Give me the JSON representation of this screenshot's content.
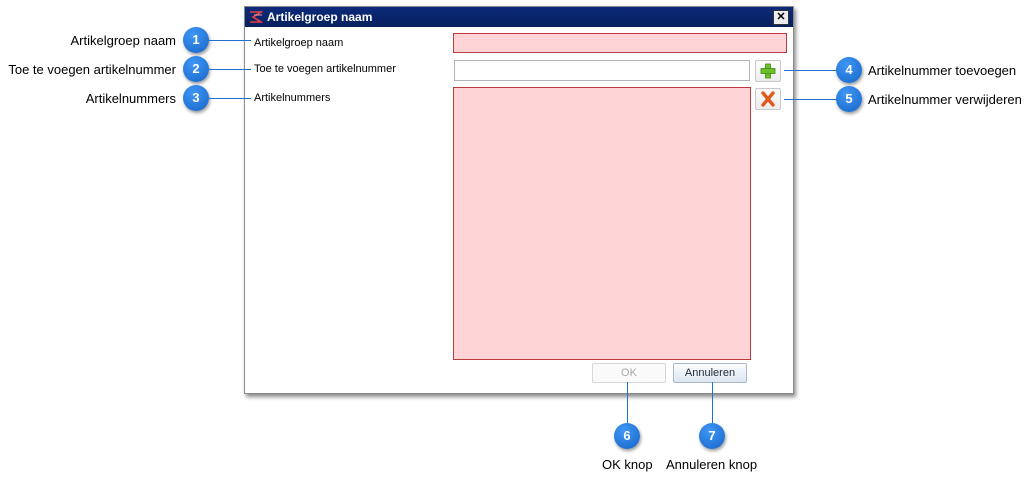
{
  "dialog": {
    "title": "Artikelgroep naam",
    "fields": {
      "name_label": "Artikelgroep naam",
      "name_value": "",
      "add_label": "Toe te voegen artikelnummer",
      "add_value": "",
      "list_label": "Artikelnummers"
    },
    "buttons": {
      "ok": "OK",
      "cancel": "Annuleren"
    },
    "icons": {
      "add": "plus-icon",
      "remove": "delete-x-icon",
      "close": "close-icon"
    },
    "colors": {
      "titlebar": "#0a246a",
      "invalid_bg": "#ffd4d6",
      "invalid_border": "#c0393b",
      "add_icon": "#6cbf2a",
      "remove_icon": "#e05a20"
    }
  },
  "callouts": [
    {
      "num": "1",
      "text": "Artikelgroep naam"
    },
    {
      "num": "2",
      "text": "Toe te voegen artikelnummer"
    },
    {
      "num": "3",
      "text": "Artikelnummers"
    },
    {
      "num": "4",
      "text": "Artikelnummer toevoegen"
    },
    {
      "num": "5",
      "text": "Artikelnummer verwijderen"
    },
    {
      "num": "6",
      "text": "OK knop"
    },
    {
      "num": "7",
      "text": "Annuleren knop"
    }
  ],
  "callout_color": "#1e7be0"
}
